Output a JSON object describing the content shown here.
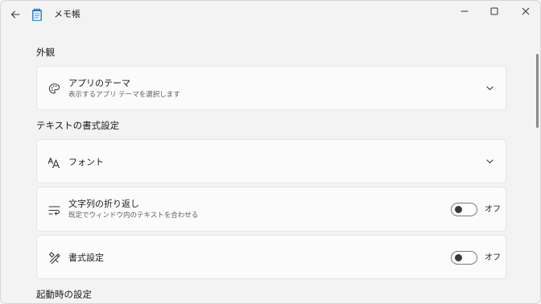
{
  "titlebar": {
    "title": "メモ帳"
  },
  "sections": {
    "appearance": {
      "heading": "外観",
      "theme": {
        "title": "アプリのテーマ",
        "subtitle": "表示するアプリ テーマを選択します"
      }
    },
    "text_format": {
      "heading": "テキストの書式設定",
      "font": {
        "title": "フォント"
      },
      "word_wrap": {
        "title": "文字列の折り返し",
        "subtitle": "既定でウィンドウ内のテキストを合わせる",
        "state_label": "オフ",
        "on": false
      },
      "formatting": {
        "title": "書式設定",
        "state_label": "オフ",
        "on": false
      }
    },
    "startup": {
      "heading": "起動時の設定"
    }
  },
  "icons": {
    "back": "back-arrow-icon",
    "app": "notepad-icon",
    "minimize": "minimize-icon",
    "maximize": "maximize-icon",
    "close": "close-icon",
    "theme": "palette-icon",
    "font": "font-icon",
    "word_wrap": "word-wrap-icon",
    "formatting": "formatting-icon",
    "chevron": "chevron-down-icon"
  },
  "colors": {
    "background": "#f3f3f3",
    "card": "#fbfbfb",
    "app_icon_accent": "#1e6fd0"
  }
}
